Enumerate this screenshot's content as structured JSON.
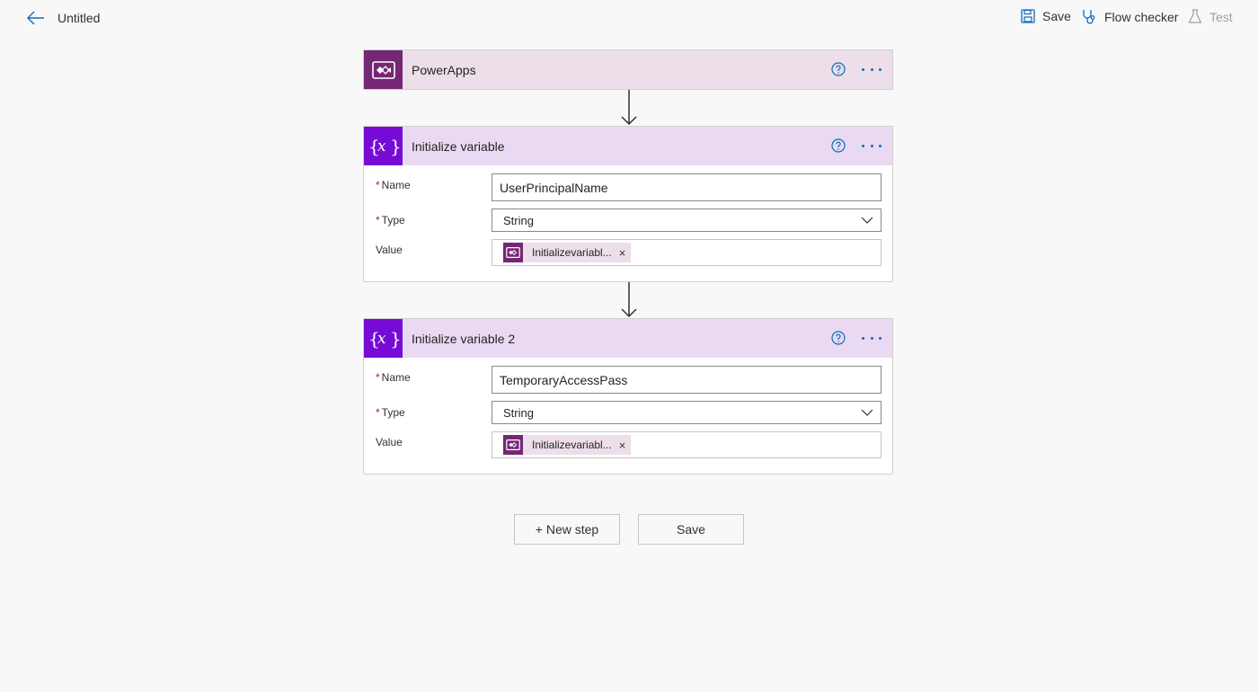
{
  "header": {
    "title": "Untitled",
    "commands": {
      "save": "Save",
      "flow_checker": "Flow checker",
      "test": "Test"
    }
  },
  "steps": {
    "trigger": {
      "title": "PowerApps"
    },
    "var1": {
      "title": "Initialize variable",
      "name_label": "Name",
      "name_value": "UserPrincipalName",
      "type_label": "Type",
      "type_value": "String",
      "value_label": "Value",
      "value_token": "Initializevariabl...",
      "token_remove": "×"
    },
    "var2": {
      "title": "Initialize variable 2",
      "name_label": "Name",
      "name_value": "TemporaryAccessPass",
      "type_label": "Type",
      "type_value": "String",
      "value_label": "Value",
      "value_token": "Initializevariabl...",
      "token_remove": "×"
    }
  },
  "footer": {
    "new_step": "+ New step",
    "save": "Save"
  },
  "required_marker": "*",
  "colors": {
    "powerapps": "#742774",
    "variable": "#770bd6",
    "accent": "#0f6cbd"
  }
}
